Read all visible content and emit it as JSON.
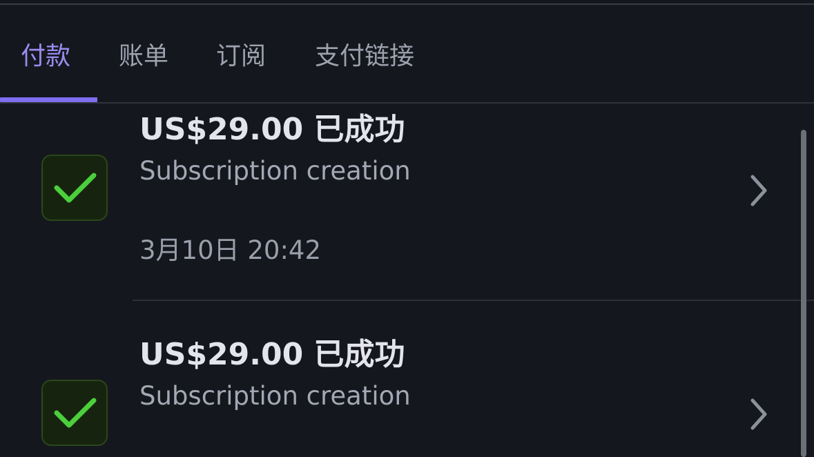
{
  "tabs": [
    {
      "label": "付款",
      "active": true
    },
    {
      "label": "账单",
      "active": false
    },
    {
      "label": "订阅",
      "active": false
    },
    {
      "label": "支付链接",
      "active": false
    }
  ],
  "payments": [
    {
      "amount": "US$29.00 已成功",
      "description": "Subscription creation",
      "timestamp": "3月10日 20:42",
      "status_icon": "checkmark-icon"
    },
    {
      "amount": "US$29.00 已成功",
      "description": "Subscription creation",
      "status_icon": "checkmark-icon"
    }
  ],
  "colors": {
    "accent": "#7f6ef0",
    "success": "#4ccf3c",
    "background": "#15171e"
  }
}
